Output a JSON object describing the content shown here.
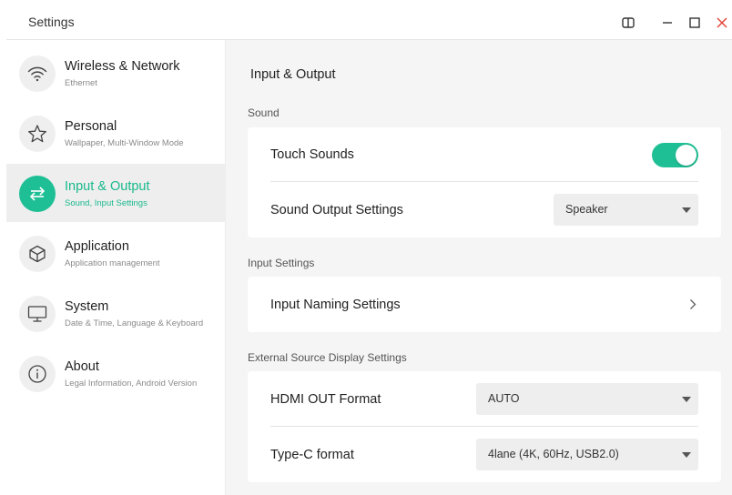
{
  "window": {
    "title": "Settings",
    "controls": [
      "split-view-icon",
      "minimize-icon",
      "maximize-icon",
      "close-icon"
    ]
  },
  "sidebar": {
    "items": [
      {
        "label": "Wireless & Network",
        "sub": "Ethernet",
        "icon": "wifi-icon"
      },
      {
        "label": "Personal",
        "sub": "Wallpaper, Multi-Window Mode",
        "icon": "star-icon"
      },
      {
        "label": "Input & Output",
        "sub": "Sound, Input Settings",
        "icon": "swap-arrows-icon",
        "active": true
      },
      {
        "label": "Application",
        "sub": "Application management",
        "icon": "cube-icon"
      },
      {
        "label": "System",
        "sub": "Date & Time, Language & Keyboard",
        "icon": "monitor-icon"
      },
      {
        "label": "About",
        "sub": "Legal Information, Android Version",
        "icon": "info-icon"
      }
    ]
  },
  "main": {
    "title": "Input & Output",
    "sections": {
      "sound": {
        "label": "Sound",
        "touch_sounds": {
          "label": "Touch Sounds",
          "enabled": true
        },
        "sound_output": {
          "label": "Sound Output Settings",
          "value": "Speaker"
        }
      },
      "input": {
        "label": "Input Settings",
        "input_naming": {
          "label": "Input Naming Settings"
        }
      },
      "external": {
        "label": "External Source Display Settings",
        "hdmi_out": {
          "label": "HDMI OUT Format",
          "value": "AUTO"
        },
        "typec": {
          "label": "Type-C format",
          "value": "4lane (4K, 60Hz, USB2.0)"
        }
      }
    }
  },
  "colors": {
    "accent": "#1fbf95",
    "active_text": "#19b98c",
    "close": "#e0463a"
  }
}
